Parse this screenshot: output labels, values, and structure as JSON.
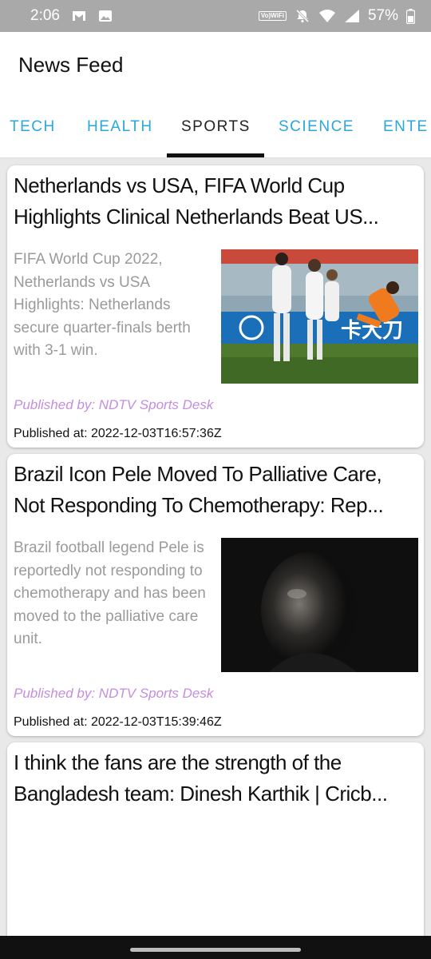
{
  "status_bar": {
    "time": "2:06",
    "battery": "57%",
    "volte_label_1": "Vo)",
    "volte_label_2": "WiFi"
  },
  "app_bar": {
    "title": "News Feed"
  },
  "tabs": [
    {
      "label": "TECH",
      "active": false
    },
    {
      "label": "HEALTH",
      "active": false
    },
    {
      "label": "SPORTS",
      "active": true
    },
    {
      "label": "SCIENCE",
      "active": false
    },
    {
      "label": "ENTE",
      "active": false
    }
  ],
  "articles": [
    {
      "title": "Netherlands vs USA, FIFA World Cup Highlights Clinical Netherlands Beat US...",
      "description": "FIFA World Cup 2022, Netherlands vs USA Highlights: Netherlands secure quarter-finals berth with 3-1 win.",
      "source": "Published by: NDTV Sports Desk",
      "published": "Published at: 2022-12-03T16:57:36Z",
      "image": "football-match-photo"
    },
    {
      "title": "Brazil Icon Pele Moved To Palliative Care, Not Responding To Chemotherapy: Rep...",
      "description": "Brazil football legend Pele is reportedly not responding to chemotherapy and has been moved to the palliative care unit.",
      "source": "Published by: NDTV Sports Desk",
      "published": "Published at: 2022-12-03T15:39:46Z",
      "image": "portrait-photo"
    },
    {
      "title": "I think the fans are the strength of the Bangladesh team: Dinesh Karthik | Cricb...",
      "description": "",
      "source": "",
      "published": "",
      "image": ""
    }
  ],
  "colors": {
    "tab_inactive": "#2aa7dc",
    "tab_active": "#222222",
    "source_text": "#c48de0",
    "description_text": "#9a9a9a",
    "status_bar_bg": "#a9a9a9"
  },
  "icons": {
    "status_left": [
      "gmail-icon",
      "image-icon"
    ],
    "status_right": [
      "volte-icon",
      "mute-icon",
      "wifi-icon",
      "signal-icon",
      "battery-icon"
    ]
  }
}
